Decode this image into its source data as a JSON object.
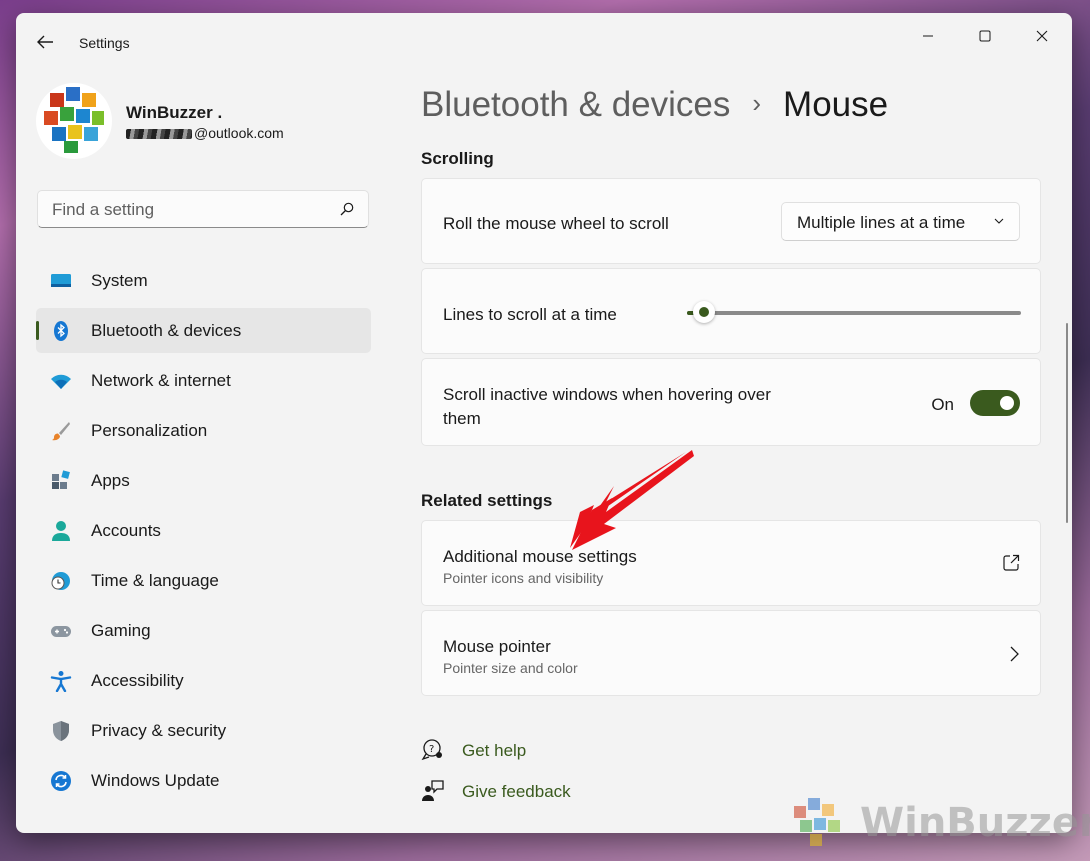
{
  "window": {
    "title": "Settings"
  },
  "profile": {
    "name": "WinBuzzer .",
    "email_domain": "@outlook.com"
  },
  "search": {
    "placeholder": "Find a setting"
  },
  "nav": {
    "items": [
      {
        "label": "System",
        "icon": "monitor-icon"
      },
      {
        "label": "Bluetooth & devices",
        "icon": "bluetooth-icon",
        "active": true
      },
      {
        "label": "Network & internet",
        "icon": "wifi-icon"
      },
      {
        "label": "Personalization",
        "icon": "brush-icon"
      },
      {
        "label": "Apps",
        "icon": "apps-icon"
      },
      {
        "label": "Accounts",
        "icon": "person-icon"
      },
      {
        "label": "Time & language",
        "icon": "globe-clock-icon"
      },
      {
        "label": "Gaming",
        "icon": "gamepad-icon"
      },
      {
        "label": "Accessibility",
        "icon": "accessibility-icon"
      },
      {
        "label": "Privacy & security",
        "icon": "shield-icon"
      },
      {
        "label": "Windows Update",
        "icon": "update-icon"
      }
    ]
  },
  "breadcrumb": {
    "parent": "Bluetooth & devices",
    "separator": "›",
    "current": "Mouse"
  },
  "scrolling": {
    "heading": "Scrolling",
    "wheel": {
      "label": "Roll the mouse wheel to scroll",
      "value": "Multiple lines at a time"
    },
    "lines": {
      "label": "Lines to scroll at a time",
      "level": 0.05
    },
    "inactive": {
      "label_line1": "Scroll inactive windows when hovering over",
      "label_line2": "them",
      "state": "On"
    }
  },
  "related": {
    "heading": "Related settings",
    "additional": {
      "title": "Additional mouse settings",
      "desc": "Pointer icons and visibility"
    },
    "pointer": {
      "title": "Mouse pointer",
      "desc": "Pointer size and color"
    }
  },
  "help": {
    "get_help": "Get help",
    "feedback": "Give feedback"
  },
  "watermark": {
    "text": "WinBuzzer"
  },
  "colors": {
    "accent": "#3a5a1e",
    "window_bg": "#f3f3f3",
    "card_bg": "#fbfbfb",
    "arrow": "#e8141c"
  }
}
